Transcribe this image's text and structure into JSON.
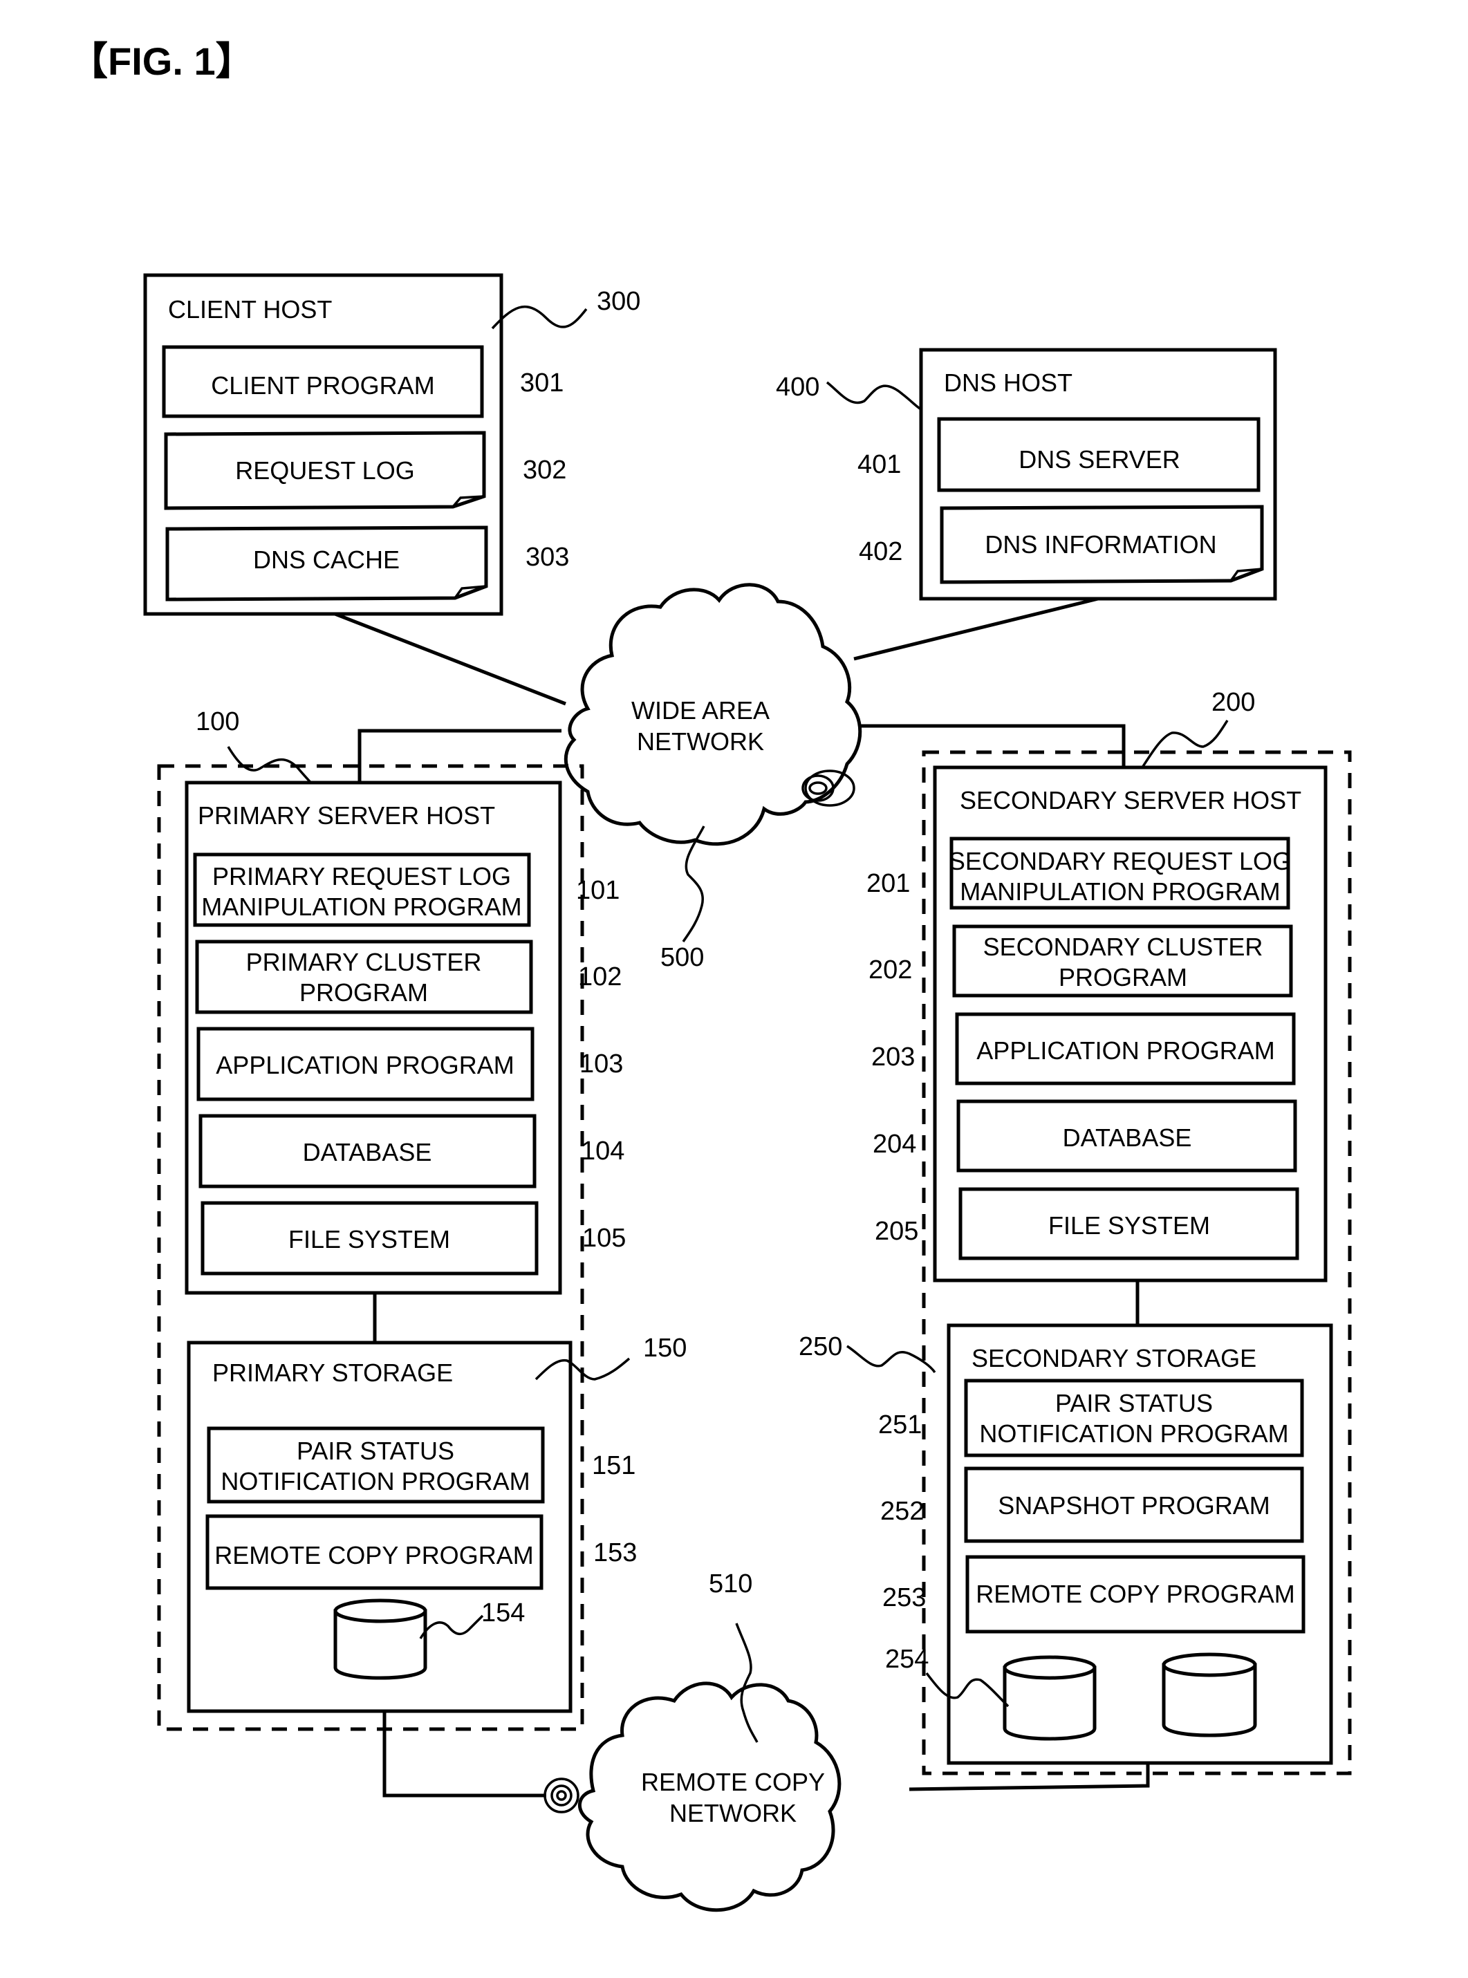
{
  "figure": {
    "label": "【FIG. 1】"
  },
  "client_host": {
    "ref": "300",
    "title": "CLIENT HOST",
    "items": [
      {
        "ref": "301",
        "label": "CLIENT PROGRAM"
      },
      {
        "ref": "302",
        "label": "REQUEST LOG"
      },
      {
        "ref": "303",
        "label": "DNS CACHE"
      }
    ]
  },
  "dns_host": {
    "ref": "400",
    "title": "DNS HOST",
    "items": [
      {
        "ref": "401",
        "label": "DNS SERVER"
      },
      {
        "ref": "402",
        "label": "DNS INFORMATION"
      }
    ]
  },
  "wide_area_network": {
    "ref": "500",
    "lines": [
      "WIDE AREA",
      "NETWORK"
    ]
  },
  "remote_copy_network": {
    "ref": "510",
    "lines": [
      "REMOTE COPY",
      "NETWORK"
    ]
  },
  "primary_site": {
    "ref": "100",
    "server_host": {
      "title": "PRIMARY SERVER HOST",
      "items": [
        {
          "ref": "101",
          "lines": [
            "PRIMARY REQUEST LOG",
            "MANIPULATION PROGRAM"
          ]
        },
        {
          "ref": "102",
          "lines": [
            "PRIMARY CLUSTER",
            "PROGRAM"
          ]
        },
        {
          "ref": "103",
          "lines": [
            "APPLICATION PROGRAM"
          ]
        },
        {
          "ref": "104",
          "lines": [
            "DATABASE"
          ]
        },
        {
          "ref": "105",
          "lines": [
            "FILE SYSTEM"
          ]
        }
      ]
    },
    "storage": {
      "ref": "150",
      "title": "PRIMARY STORAGE",
      "items": [
        {
          "ref": "151",
          "lines": [
            "PAIR STATUS",
            "NOTIFICATION PROGRAM"
          ]
        },
        {
          "ref": "153",
          "lines": [
            "REMOTE COPY PROGRAM"
          ]
        }
      ],
      "volume_ref": "154"
    }
  },
  "secondary_site": {
    "ref": "200",
    "server_host": {
      "title": "SECONDARY SERVER HOST",
      "items": [
        {
          "ref": "201",
          "lines": [
            "SECONDARY REQUEST LOG",
            "MANIPULATION PROGRAM"
          ]
        },
        {
          "ref": "202",
          "lines": [
            "SECONDARY CLUSTER",
            "PROGRAM"
          ]
        },
        {
          "ref": "203",
          "lines": [
            "APPLICATION PROGRAM"
          ]
        },
        {
          "ref": "204",
          "lines": [
            "DATABASE"
          ]
        },
        {
          "ref": "205",
          "lines": [
            "FILE SYSTEM"
          ]
        }
      ]
    },
    "storage": {
      "ref": "250",
      "title": "SECONDARY STORAGE",
      "items": [
        {
          "ref": "251",
          "lines": [
            "PAIR STATUS",
            "NOTIFICATION PROGRAM"
          ]
        },
        {
          "ref": "252",
          "lines": [
            "SNAPSHOT PROGRAM"
          ]
        },
        {
          "ref": "253",
          "lines": [
            "REMOTE COPY PROGRAM"
          ]
        }
      ],
      "volume_ref": "254"
    }
  }
}
